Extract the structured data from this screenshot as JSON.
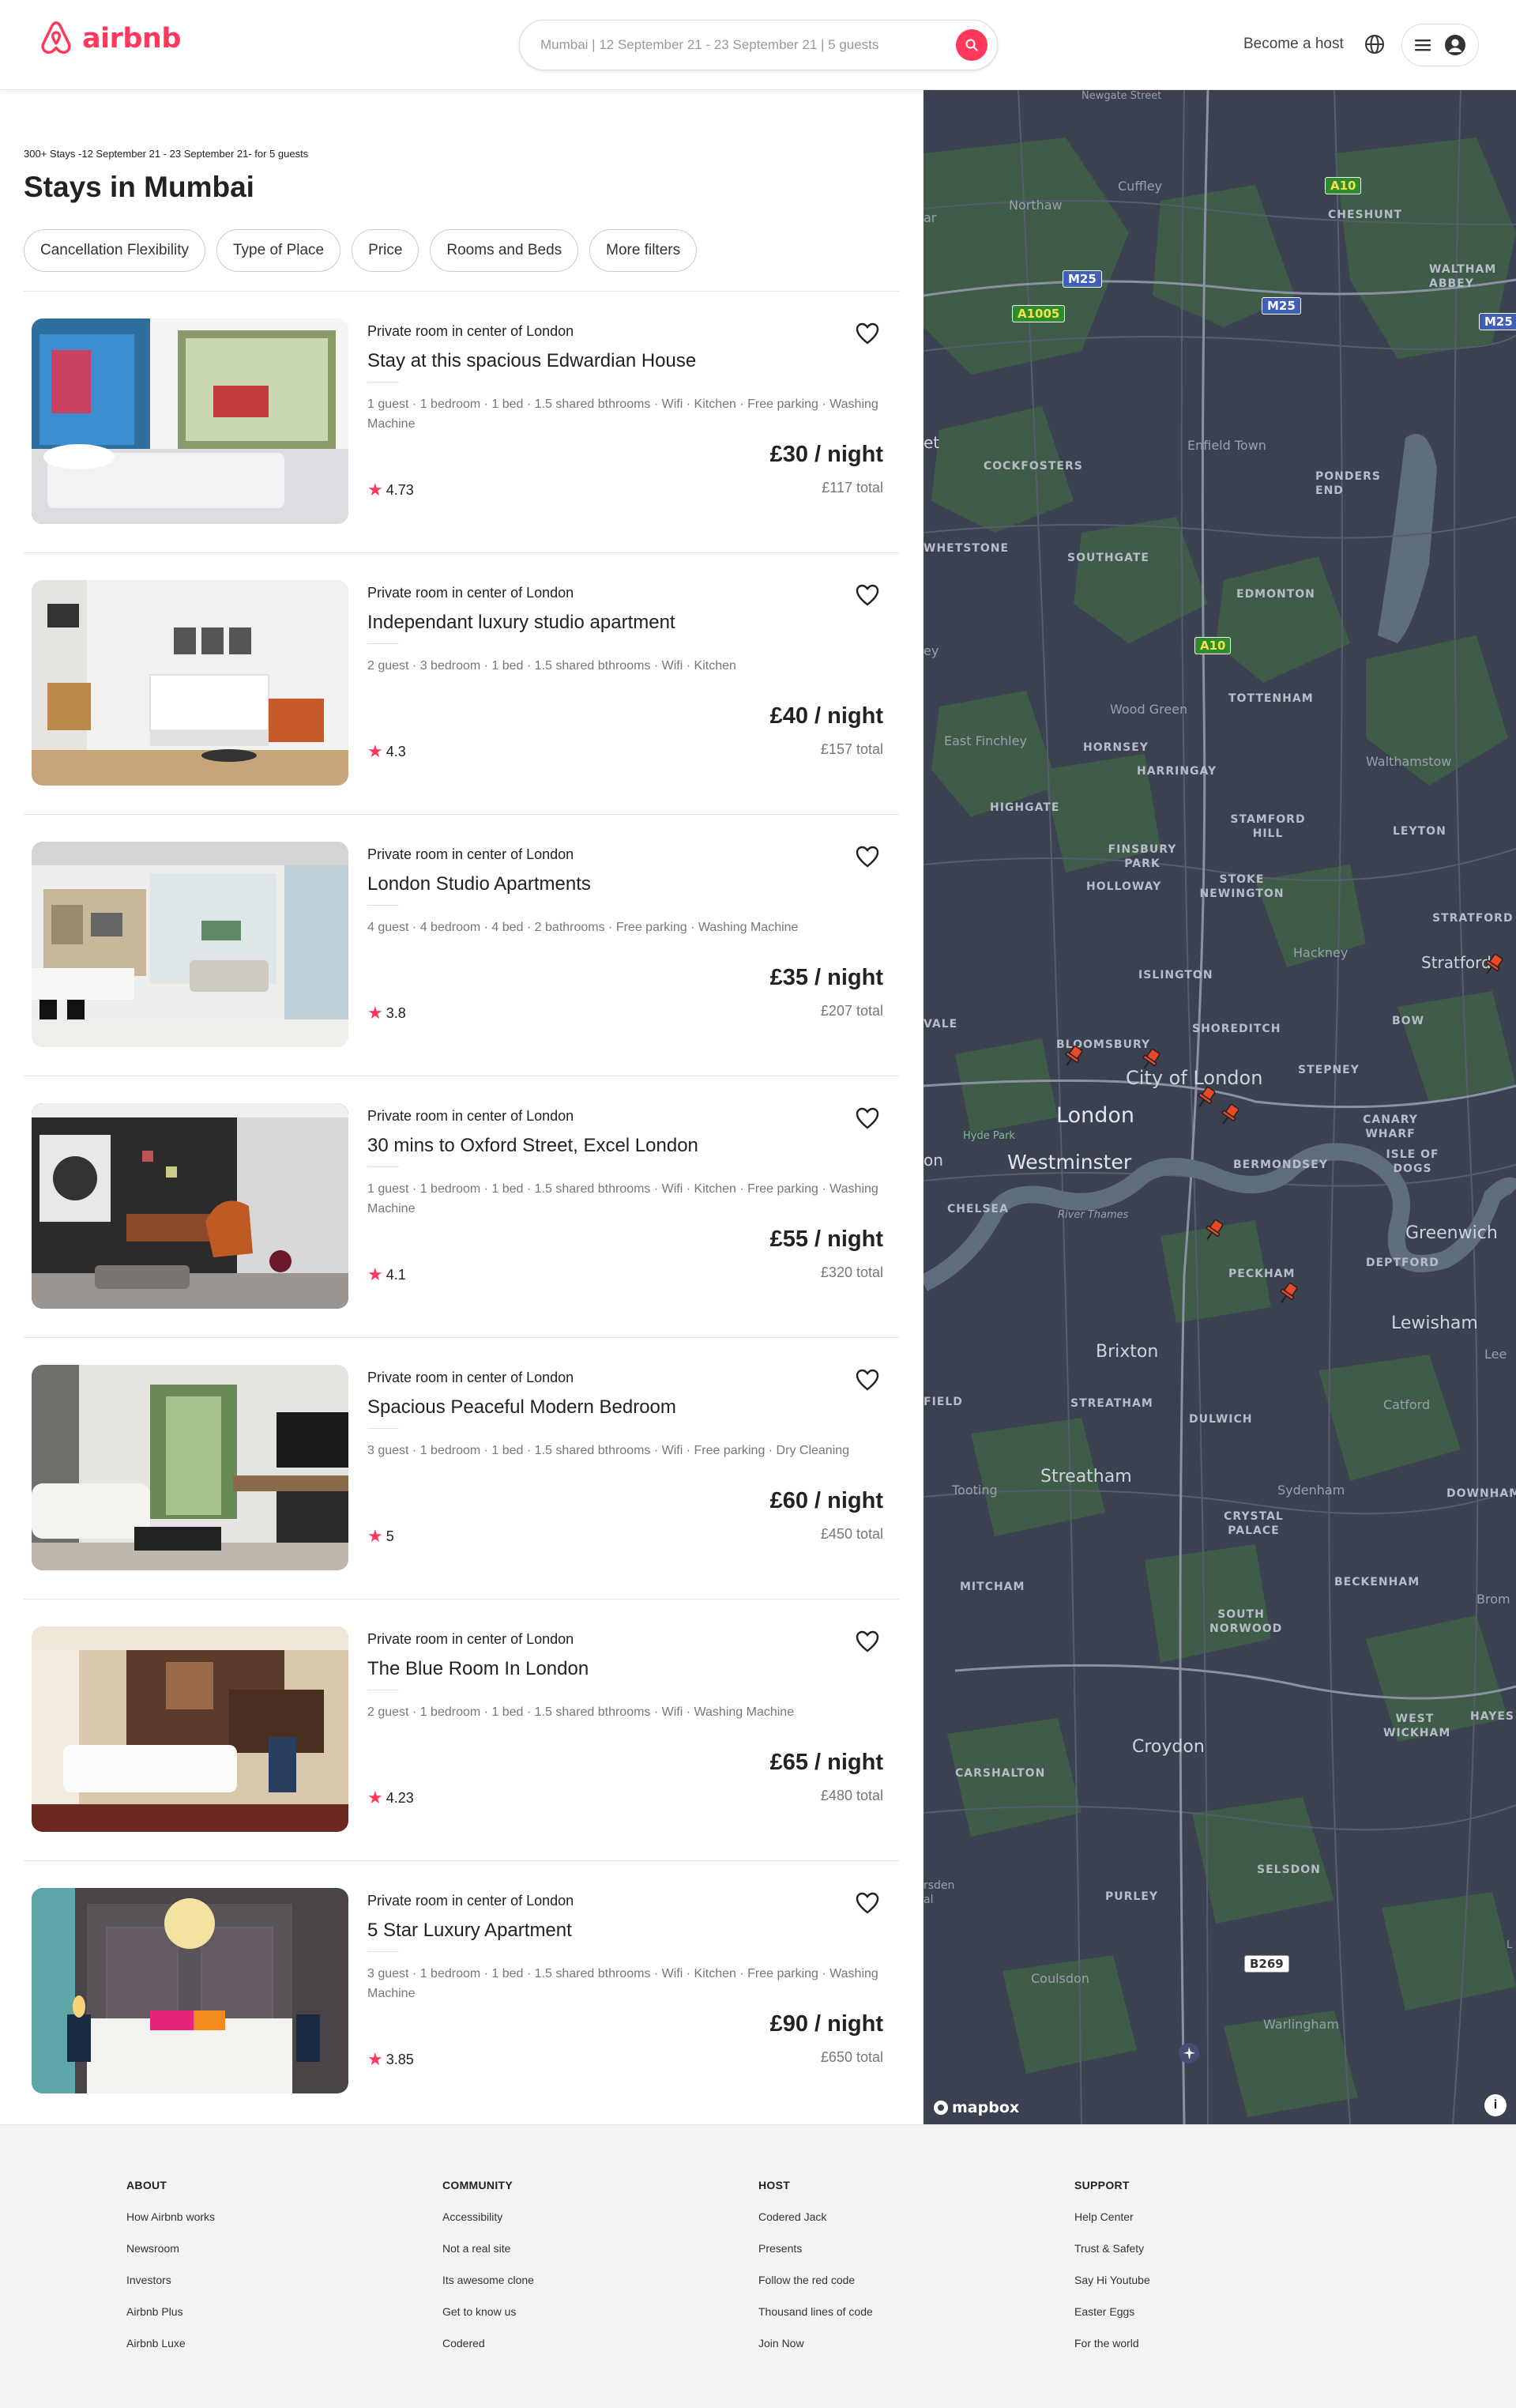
{
  "brand": {
    "name": "airbnb",
    "color": "#ff385c"
  },
  "header": {
    "search_text": "Mumbai | 12 September 21 - 23 September 21 | 5 guests",
    "host_link": "Become a host",
    "icons": [
      "search-icon",
      "globe-icon",
      "menu-icon",
      "user-icon"
    ]
  },
  "results": {
    "summary": "300+ Stays -12 September 21 - 23 September 21- for 5 guests",
    "heading": "Stays in Mumbai",
    "filters": [
      "Cancellation Flexibility",
      "Type of Place",
      "Price",
      "Rooms and Beds",
      "More filters"
    ]
  },
  "listings": [
    {
      "subtitle": "Private room in center of London",
      "title": "Stay at this spacious Edwardian House",
      "description": "1 guest · 1 bedroom · 1 bed · 1.5 shared bthrooms · Wifi · Kitchen · Free parking · Washing Machine",
      "price": "£30 / night",
      "total": "£117 total",
      "rating": "4.73"
    },
    {
      "subtitle": "Private room in center of London",
      "title": "Independant luxury studio apartment",
      "description": "2 guest · 3 bedroom · 1 bed · 1.5 shared bthrooms · Wifi · Kitchen",
      "price": "£40 / night",
      "total": "£157 total",
      "rating": "4.3"
    },
    {
      "subtitle": "Private room in center of London",
      "title": "London Studio Apartments",
      "description": "4 guest · 4 bedroom · 4 bed · 2 bathrooms · Free parking · Washing Machine",
      "price": "£35 / night",
      "total": "£207 total",
      "rating": "3.8"
    },
    {
      "subtitle": "Private room in center of London",
      "title": "30 mins to Oxford Street, Excel London",
      "description": "1 guest · 1 bedroom · 1 bed · 1.5 shared bthrooms · Wifi · Kitchen · Free parking · Washing Machine",
      "price": "£55 / night",
      "total": "£320 total",
      "rating": "4.1"
    },
    {
      "subtitle": "Private room in center of London",
      "title": "Spacious Peaceful Modern Bedroom",
      "description": "3 guest · 1 bedroom · 1 bed · 1.5 shared bthrooms · Wifi · Free parking · Dry Cleaning",
      "price": "£60 / night",
      "total": "£450 total",
      "rating": "5"
    },
    {
      "subtitle": "Private room in center of London",
      "title": "The Blue Room In London",
      "description": "2 guest · 1 bedroom · 1 bed · 1.5 shared bthrooms · Wifi · Washing Machine",
      "price": "£65 / night",
      "total": "£480 total",
      "rating": "4.23"
    },
    {
      "subtitle": "Private room in center of London",
      "title": "5 Star Luxury Apartment",
      "description": "3 guest · 1 bedroom · 1 bed · 1.5 shared bthrooms · Wifi · Kitchen · Free parking · Washing Machine",
      "price": "£90 / night",
      "total": "£650 total",
      "rating": "3.85"
    }
  ],
  "map": {
    "attribution": "mapbox",
    "info": "i",
    "labels": {
      "newgate": "Newgate Street",
      "cuffley": "Cuffley",
      "northaw": "Northaw",
      "cheshunt": "CHESHUNT",
      "waltham_abbey": "WALTHAM ABBEY",
      "cockfosters": "COCKFOSTERS",
      "enfield": "Enfield Town",
      "ponders_end": "PONDERS END",
      "whetstone": "WHETSTONE",
      "southgate": "SOUTHGATE",
      "edmonton": "EDMONTON",
      "wood_green": "Wood Green",
      "tottenham": "TOTTENHAM",
      "east_finchley": "East Finchley",
      "hornsey": "HORNSEY",
      "harringay": "HARRINGAY",
      "walthamstow": "Walthamstow",
      "highgate": "HIGHGATE",
      "stamford_hill": "STAMFORD HILL",
      "leyton": "LEYTON",
      "finsbury_park": "FINSBURY PARK",
      "holloway": "HOLLOWAY",
      "stoke_newington": "STOKE NEWINGTON",
      "stratford_caps": "STRATFORD",
      "hackney": "Hackney",
      "stratford": "Stratford",
      "islington": "ISLINGTON",
      "vale": "VALE",
      "bow": "BOW",
      "shoreditch": "SHOREDITCH",
      "bloomsbury": "BLOOMSBURY",
      "stepney": "STEPNEY",
      "city": "City of London",
      "london": "London",
      "hyde_park": "Hyde Park",
      "canary_wharf": "CANARY WHARF",
      "isle_of_dogs": "ISLE OF DOGS",
      "on": "on",
      "westminster": "Westminster",
      "bermondsey": "BERMONDSEY",
      "chelsea": "CHELSEA",
      "river_thames": "River Thames",
      "greenwich": "Greenwich",
      "peckham": "PECKHAM",
      "deptford": "DEPTFORD",
      "lewisham": "Lewisham",
      "lee": "Lee",
      "brixton": "Brixton",
      "field": "FIELD",
      "streatham_caps": "STREATHAM",
      "dulwich": "DULWICH",
      "catford": "Catford",
      "tooting": "Tooting",
      "streatham": "Streatham",
      "sydenham": "Sydenham",
      "downham": "DOWNHAM",
      "crystal_palace": "CRYSTAL PALACE",
      "mitcham": "MITCHAM",
      "beckenham": "BECKENHAM",
      "brom": "Brom",
      "south_norwood": "SOUTH NORWOOD",
      "west_wickham": "WEST WICKHAM",
      "hayes": "HAYES",
      "croydon": "Croydon",
      "carshalton": "CARSHALTON",
      "selsdon": "SELSDON",
      "rsden": "rsden",
      "al": "al",
      "purley": "PURLEY",
      "coulsdon": "Coulsdon",
      "warlingham": "Warlingham",
      "et": "et",
      "ar": "ar",
      "ey": "ey",
      "l": "L"
    },
    "roads": {
      "a10_top": "A10",
      "m25_left": "M25",
      "m25_mid": "M25",
      "m25_right": "M25",
      "a1005": "A1005",
      "a10_mid": "A10",
      "b269": "B269"
    },
    "pin_count": 7,
    "colors": {
      "land": "#3b4150",
      "park": "#3e5c48",
      "water": "#5f6d7e",
      "pin": "#e8492b"
    }
  },
  "footer": {
    "columns": [
      {
        "heading": "ABOUT",
        "links": [
          "How Airbnb works",
          "Newsroom",
          "Investors",
          "Airbnb Plus",
          "Airbnb Luxe"
        ]
      },
      {
        "heading": "COMMUNITY",
        "links": [
          "Accessibility",
          "Not a real site",
          "Its awesome clone",
          "Get to know us",
          "Codered"
        ]
      },
      {
        "heading": "HOST",
        "links": [
          "Codered Jack",
          "Presents",
          "Follow the red code",
          "Thousand lines of code",
          "Join Now"
        ]
      },
      {
        "heading": "SUPPORT",
        "links": [
          "Help Center",
          "Trust & Safety",
          "Say Hi Youtube",
          "Easter Eggs",
          "For the world"
        ]
      }
    ]
  }
}
